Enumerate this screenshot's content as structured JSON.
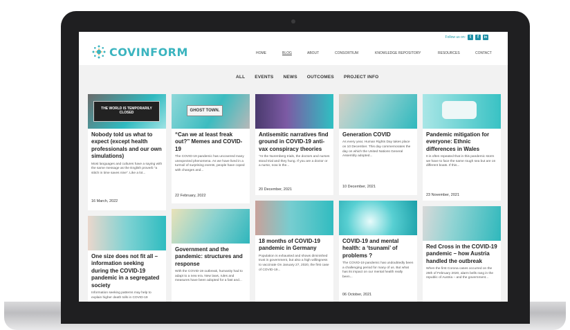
{
  "social": {
    "follow_label": "Follow us on:",
    "icons": [
      "twitter-icon",
      "facebook-icon",
      "linkedin-icon"
    ],
    "twitter_glyph": "t",
    "facebook_glyph": "f",
    "linkedin_glyph": "in"
  },
  "brand": {
    "name": "COVINFORM",
    "color": "#3bb4bf"
  },
  "nav": [
    "HOME",
    "BLOG",
    "ABOUT",
    "CONSORTIUM",
    "KNOWLEDGE REPOSITORY",
    "RESOURCES",
    "CONTACT"
  ],
  "filters": [
    "ALL",
    "EVENTS",
    "NEWS",
    "OUTCOMES",
    "PROJECT INFO"
  ],
  "cards": [
    {
      "title": "Nobody told us what to expect (except health professionals and our own simulations)",
      "excerpt": "Most languages and cultures have a saying with the same message as the English proverb “a stitch in time saves nine”. Like a lot...",
      "date": "16 March, 2022",
      "thumb_text": "THE WORLD IS TEMPORARILY CLOSED"
    },
    {
      "title": "“Can we at least freak out?” Memes and COVID-19",
      "excerpt": "The COVID-19 pandemic has uncovered many unexpected phenomena. As we have lived in a turmoil of surprising events, people have coped with changes and...",
      "date": "22 February, 2022",
      "thumb_text": "GHOST TOWN."
    },
    {
      "title": "Antisemitic narratives find ground in COVID-19 anti-vax conspiracy theories",
      "excerpt": "“At the Nuremberg trials, the doctors and nurses stood trial and they hung. If you are a doctor or a nurse, now is the...",
      "date": "20 December, 2021",
      "thumb_text": ""
    },
    {
      "title": "Generation COVID",
      "excerpt": "As every year, Human Rights Day takes place on 10 December. This day commemorates the day on which the United Nations General Assembly adopted...",
      "date": "10 December, 2021",
      "thumb_text": ""
    },
    {
      "title": "Pandemic mitigation for everyone: Ethnic differences in Wales",
      "excerpt": "It is often repeated that in this pandemic storm we have to face the same rough sea but are on different boats. If this...",
      "date": "23 November, 2021",
      "thumb_text": ""
    },
    {
      "title": "One size does not fit all – information seeking during the COVID-19 pandemic in a segregated society",
      "excerpt": "Information seeking patterns may help to explain higher death tolls in COVID-19",
      "date": "",
      "thumb_text": ""
    },
    {
      "title": "Government and the pandemic: structures and response",
      "excerpt": "With the COVID-19 outbreak, humanity had to adapt to a new era. New laws, rules and measures have been adopted for a fast and...",
      "date": "",
      "thumb_text": ""
    },
    {
      "title": "18 months of COVID-19 pandemic in Germany",
      "excerpt": "Population is exhausted and shows diminished trust in government, but also a high willingness to vaccinate On January 27, 2020, the first case of COVID-19...",
      "date": "",
      "thumb_text": ""
    },
    {
      "title": "COVID-19 and mental health: a ‘tsunami’ of problems ?",
      "excerpt": "The COVID-19 pandemic has undoubtedly been a challenging period for many of us. But what has its impact on our mental health really been...",
      "date": "06 October, 2021",
      "thumb_text": ""
    },
    {
      "title": "Red Cross in the COVID-19 pandemic – how Austria handled the outbreak",
      "excerpt": "When the first Corona cases occurred on the 25th of February 2020, alarm bells rang in the republic of Austria – and the government...",
      "date": "",
      "thumb_text": ""
    }
  ],
  "colors": {
    "teal": "#37c3c6",
    "dark_teal": "#1e8fa6",
    "bg": "#f2f2f2"
  }
}
